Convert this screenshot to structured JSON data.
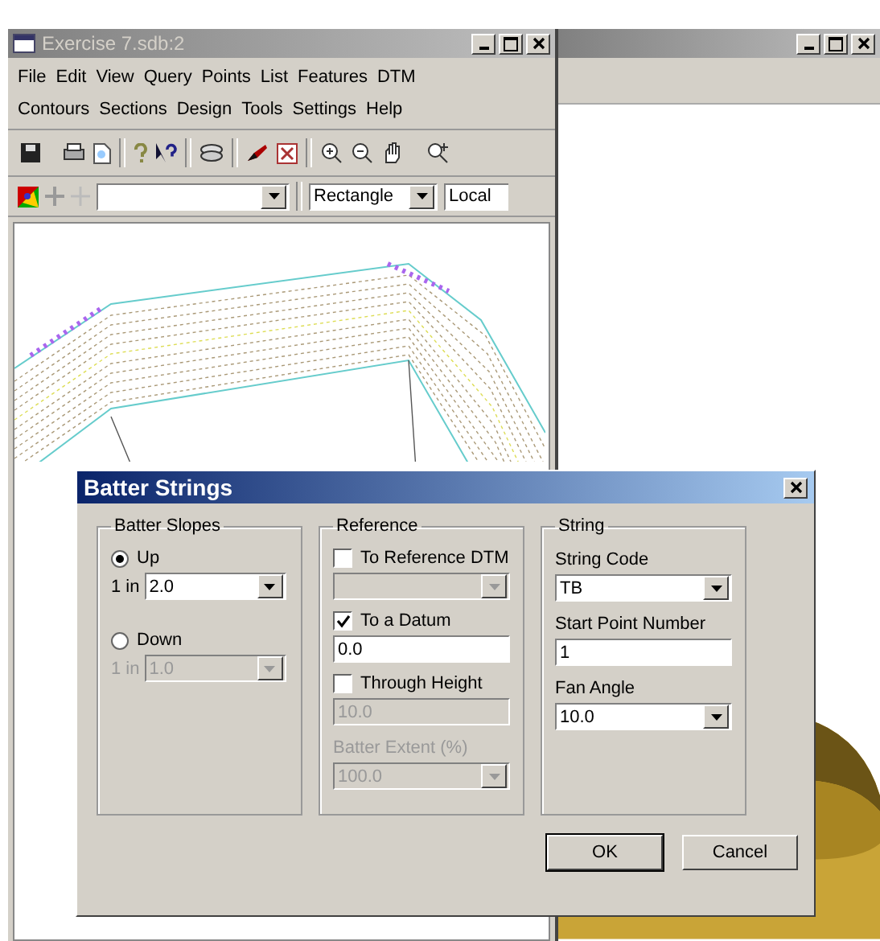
{
  "main_window": {
    "title": "Exercise 7.sdb:2",
    "active": false
  },
  "menu_bar": {
    "items": [
      "File",
      "Edit",
      "View",
      "Query",
      "Points",
      "List",
      "Features",
      "DTM",
      "Contours",
      "Sections",
      "Design",
      "Tools",
      "Settings",
      "Help"
    ]
  },
  "selection_combo": {
    "value": "Rectangle"
  },
  "coordinate_combo": {
    "value": "Local"
  },
  "dialog": {
    "title": "Batter Strings",
    "batter_slopes": {
      "title": "Batter Slopes",
      "options": [
        {
          "label": "Up",
          "selected": true,
          "ratio_label": "1 in",
          "value": "2.0"
        },
        {
          "label": "Down",
          "selected": false,
          "ratio_label": "1 in",
          "value": "1.0"
        }
      ]
    },
    "reference": {
      "title": "Reference",
      "options": [
        {
          "kind": "combo",
          "label": "To Reference DTM",
          "checked": false
        },
        {
          "kind": "field",
          "label": "To a Datum",
          "checked": true,
          "value": "0.0"
        },
        {
          "kind": "field",
          "label": "Through Height",
          "checked": false,
          "value": "10.0"
        }
      ],
      "extent": {
        "label": "Batter Extent (%)",
        "value": "100.0",
        "disabled": true
      }
    },
    "string": {
      "title": "String",
      "fields": [
        {
          "kind": "combo",
          "label": "String Code",
          "value": "TB"
        },
        {
          "kind": "field",
          "label": "Start Point Number",
          "value": "1"
        },
        {
          "kind": "combo",
          "label": "Fan Angle",
          "value": "10.0"
        }
      ]
    },
    "buttons": [
      {
        "label": "OK",
        "default": true
      },
      {
        "label": "Cancel",
        "default": false
      }
    ]
  }
}
